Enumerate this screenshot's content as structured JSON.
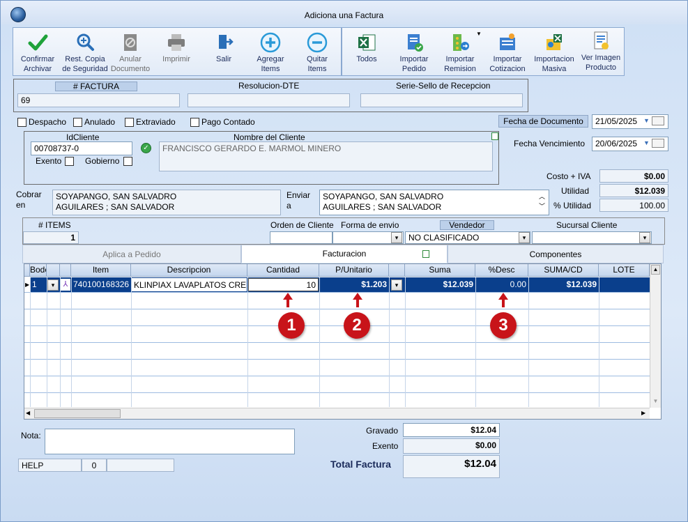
{
  "window": {
    "title": "Adiciona una Factura"
  },
  "toolbar": {
    "left": [
      {
        "label1": "Confirmar",
        "label2": "Archivar",
        "icon": "check-icon"
      },
      {
        "label1": "Rest. Copia",
        "label2": "de Seguridad",
        "icon": "zoom-plus-icon"
      },
      {
        "label1": "Anular",
        "label2": "Documento",
        "icon": "cancel-document-icon"
      },
      {
        "label1": "Imprimir",
        "label2": "",
        "icon": "printer-icon"
      },
      {
        "label1": "Salir",
        "label2": "",
        "icon": "exit-door-icon"
      },
      {
        "label1": "Agregar",
        "label2": "Items",
        "icon": "plus-circle-icon"
      },
      {
        "label1": "Quitar",
        "label2": "Items",
        "icon": "minus-circle-icon"
      }
    ],
    "right": [
      {
        "label1": "Todos",
        "label2": "",
        "icon": "excel-icon"
      },
      {
        "label1": "Importar",
        "label2": "Pedido",
        "icon": "import-order-icon"
      },
      {
        "label1": "Importar",
        "label2": "Remision",
        "icon": "import-remission-icon"
      },
      {
        "label1": "Importar",
        "label2": "Cotizacion",
        "icon": "import-quote-icon"
      },
      {
        "label1": "Importacion",
        "label2": "Masiva",
        "icon": "bulk-import-icon"
      },
      {
        "label1": "Ver Imagen",
        "label2": "Producto",
        "icon": "view-product-image-icon"
      }
    ]
  },
  "header": {
    "factura_label": "# FACTURA",
    "factura_value": "69",
    "resolucion_label": "Resolucion-DTE",
    "resolucion_value": "",
    "serie_label": "Serie-Sello de Recepcion",
    "serie_value": ""
  },
  "flags": {
    "despacho": "Despacho",
    "anulado": "Anulado",
    "extraviado": "Extraviado",
    "pago_contado": "Pago Contado"
  },
  "dates": {
    "fecha_documento_label": "Fecha de  Documento",
    "fecha_documento": "21/05/2025",
    "fecha_vencimiento_label": "Fecha Vencimiento",
    "fecha_vencimiento": "20/06/2025"
  },
  "client": {
    "id_label": "IdCliente",
    "id_value": "00708737-0",
    "name_label": "Nombre del Cliente",
    "name_value": "FRANCISCO GERARDO E. MARMOL MINERO",
    "exento_label": "Exento",
    "gobierno_label": "Gobierno"
  },
  "address": {
    "cobrar_label1": "Cobrar",
    "cobrar_label2": "en",
    "cobrar_line1": "SOYAPANGO, SAN SALVADRO",
    "cobrar_line2": "AGUILARES ; SAN SALVADOR",
    "enviar_label1": "Enviar",
    "enviar_label2": "a",
    "enviar_line1": "SOYAPANGO, SAN SALVADRO",
    "enviar_line2": "AGUILARES ; SAN SALVADOR"
  },
  "summary": {
    "costo_iva_label": "Costo + IVA",
    "costo_iva": "$0.00",
    "utilidad_label": "Utilidad",
    "utilidad": "$12.039",
    "pct_utilidad_label": "% Utilidad",
    "pct_utilidad": "100.00"
  },
  "orderbar": {
    "items_label": "# ITEMS",
    "items_value": "1",
    "orden_label": "Orden de Cliente",
    "forma_envio_label": "Forma de envio",
    "vendedor_label": "Vendedor",
    "vendedor_value": "NO CLASIFICADO",
    "sucursal_label": "Sucursal Cliente"
  },
  "tabs": [
    {
      "label": "Aplica a Pedido"
    },
    {
      "label": "Facturacion"
    },
    {
      "label": "Componentes"
    }
  ],
  "grid": {
    "columns": [
      "Bodega",
      "",
      "Item",
      "Descripcion",
      "Cantidad",
      "P/Unitario",
      "",
      "Suma",
      "%Desc",
      "SUMA/CD",
      "LOTE"
    ],
    "row": {
      "bodega": "1",
      "item": "740100168326",
      "descripcion": "KLINPIAX LAVAPLATOS CREI",
      "cantidad": "10",
      "p_unitario": "$1.203",
      "suma": "$12.039",
      "desc": "0.00",
      "suma_cd": "$12.039",
      "lote": ""
    }
  },
  "markers": [
    "1",
    "2",
    "3"
  ],
  "footer": {
    "nota_label": "Nota:",
    "nota_value": "",
    "help_label": "HELP",
    "help_count": "0",
    "gravado_label": "Gravado",
    "gravado": "$12.04",
    "exento_label": "Exento",
    "exento": "$0.00",
    "total_label": "Total Factura",
    "total": "$12.04"
  },
  "colors": {
    "accent": "#0a3f8c",
    "marker": "#c8141a",
    "window_bg": "#dde9f8"
  }
}
